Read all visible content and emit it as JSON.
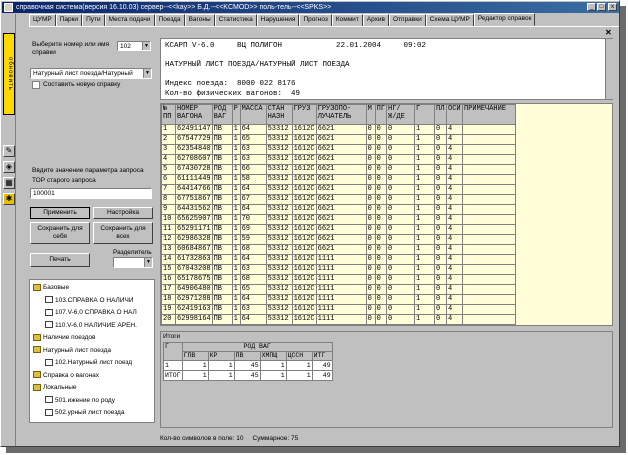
{
  "window": {
    "title": "справочная система(версия 16.10.03) сервер--<<kay>> Б.Д.--<<KCMOD>> поль-тель--<<SPKS>>",
    "controls": [
      "_",
      "□",
      "x"
    ]
  },
  "tabs": [
    "ЦУМР",
    "Парки",
    "Пути",
    "Места подачи",
    "Поезда",
    "Вагоны",
    "Статистика",
    "Нарушения",
    "Прогноз",
    "Коммит",
    "Архив",
    "Отправки",
    "Схема ЦУМР",
    "Редактор справок"
  ],
  "active_tab": 13,
  "close_glyph": "✕",
  "side": {
    "vertical_label": "обновить",
    "icons": [
      "pencil-icon",
      "paint-icon",
      "settings-icon",
      "tool-icon"
    ]
  },
  "left": {
    "choose_label": "Выберите номер или имя справки",
    "number_value": "102",
    "report_select": "Натурный лист поезда/Натурный",
    "new_report_checkbox": "Составить новую справку",
    "param_label": "Ввдите значение параметра запроса",
    "param_sub": "ТОР  старого запроса",
    "param_value": "100001",
    "buttons": {
      "apply": "Применить",
      "settings": "Настройка",
      "save_self": "Сохранить для себя",
      "save_all": "Сохранить для всех",
      "print": "Печать",
      "separator": "Разделитель"
    },
    "tree": [
      {
        "indent": 0,
        "icon": "folder",
        "label": "Базовые"
      },
      {
        "indent": 1,
        "icon": "doc",
        "label": "103.СПРАВКА О НАЛИЧИ"
      },
      {
        "indent": 1,
        "icon": "doc",
        "label": "107.V-6.0  СПРАВКА О НАЛ"
      },
      {
        "indent": 1,
        "icon": "doc",
        "label": "110.V-6.0  НАЛИЧИЕ АРЕН."
      },
      {
        "indent": 0,
        "icon": "folder",
        "label": "Наличие поездов"
      },
      {
        "indent": 0,
        "icon": "folder",
        "label": "Натурный лист поезда"
      },
      {
        "indent": 1,
        "icon": "doc",
        "label": "102.Натурный лист поезд"
      },
      {
        "indent": 0,
        "icon": "folder",
        "label": "Справка о вагонах"
      },
      {
        "indent": 0,
        "icon": "folder",
        "label": "Локальные"
      },
      {
        "indent": 1,
        "icon": "doc",
        "label": "501.ижение по роду"
      },
      {
        "indent": 1,
        "icon": "doc",
        "label": "502.урный лист поезда"
      }
    ]
  },
  "header_text": {
    "line1": "КСАРП V-6.0     ВЦ ПОЛИГОН            22.01.2004     09:02",
    "line2": "",
    "line3": "НАТУРНЫЙ ЛИСТ ПОЕЗДА/НАТУРНЫЙ ЛИСТ ПОЕЗДА",
    "line4": "",
    "line5": "Индекс поезда:  8000 022 8176",
    "line6": "Кол-во физических вагонов:  49"
  },
  "grid": {
    "columns": [
      "№ ПП",
      "НОМЕР ВАГОНА",
      "РОД ВАГ",
      "Р",
      "МАССА",
      "СТАН НАЗН",
      "ГРУЗ",
      "ГРУЗОПО- ЛУЧАТЕЛЬ",
      "М",
      "ПГ",
      "НГ/ Ж/ДЕ",
      "Г",
      "ПЛ",
      "ОСИ",
      "ПРИМЕЧАНИЕ"
    ],
    "rows": [
      [
        "1",
        "62491147",
        "ПВ",
        "1",
        "64",
        "53312",
        "1612С",
        "6621",
        "0",
        "0",
        "0",
        "1",
        "0",
        "4",
        ""
      ],
      [
        "2",
        "67547729",
        "ПВ",
        "1",
        "65",
        "53312",
        "1612С",
        "6621",
        "0",
        "0",
        "0",
        "1",
        "0",
        "4",
        ""
      ],
      [
        "3",
        "62354840",
        "ПВ",
        "1",
        "63",
        "53312",
        "1612С",
        "6621",
        "0",
        "0",
        "0",
        "1",
        "0",
        "4",
        ""
      ],
      [
        "4",
        "62708607",
        "ПВ",
        "1",
        "63",
        "53312",
        "1612С",
        "6621",
        "0",
        "0",
        "0",
        "1",
        "0",
        "4",
        ""
      ],
      [
        "5",
        "67430728",
        "ПВ",
        "1",
        "66",
        "53312",
        "1612С",
        "6621",
        "0",
        "0",
        "0",
        "1",
        "0",
        "4",
        ""
      ],
      [
        "6",
        "61111449",
        "ПВ",
        "1",
        "58",
        "53312",
        "1612С",
        "6621",
        "0",
        "0",
        "0",
        "1",
        "0",
        "4",
        ""
      ],
      [
        "7",
        "64414766",
        "ПВ",
        "1",
        "64",
        "53312",
        "1612С",
        "6621",
        "0",
        "0",
        "0",
        "1",
        "0",
        "4",
        ""
      ],
      [
        "8",
        "67751867",
        "ПВ",
        "1",
        "67",
        "53312",
        "1612С",
        "6621",
        "0",
        "0",
        "0",
        "1",
        "0",
        "4",
        ""
      ],
      [
        "9",
        "64431562",
        "ПВ",
        "1",
        "64",
        "53312",
        "1612С",
        "6621",
        "0",
        "0",
        "0",
        "1",
        "0",
        "4",
        ""
      ],
      [
        "10",
        "65625907",
        "ПВ",
        "1",
        "70",
        "53312",
        "1612С",
        "6621",
        "0",
        "0",
        "0",
        "1",
        "0",
        "4",
        ""
      ],
      [
        "11",
        "65291171",
        "ПВ",
        "1",
        "69",
        "53312",
        "1612С",
        "6621",
        "0",
        "0",
        "0",
        "1",
        "0",
        "4",
        ""
      ],
      [
        "12",
        "62986328",
        "ПВ",
        "1",
        "59",
        "53312",
        "1612С",
        "6621",
        "0",
        "0",
        "0",
        "1",
        "0",
        "4",
        ""
      ],
      [
        "13",
        "60684867",
        "ПВ",
        "1",
        "68",
        "53312",
        "1612С",
        "6621",
        "0",
        "0",
        "0",
        "1",
        "0",
        "4",
        ""
      ],
      [
        "14",
        "61732863",
        "ПВ",
        "1",
        "64",
        "53312",
        "1612С",
        "1111",
        "0",
        "0",
        "0",
        "1",
        "0",
        "4",
        ""
      ],
      [
        "15",
        "67043208",
        "ПВ",
        "1",
        "63",
        "53312",
        "1612С",
        "1111",
        "0",
        "0",
        "0",
        "1",
        "0",
        "4",
        ""
      ],
      [
        "16",
        "65178675",
        "ПВ",
        "1",
        "68",
        "53312",
        "1612С",
        "1111",
        "0",
        "0",
        "0",
        "1",
        "0",
        "4",
        ""
      ],
      [
        "17",
        "64906480",
        "ПВ",
        "1",
        "65",
        "53312",
        "1612С",
        "1111",
        "0",
        "0",
        "0",
        "1",
        "0",
        "4",
        ""
      ],
      [
        "18",
        "62971288",
        "ПВ",
        "1",
        "64",
        "53312",
        "1612С",
        "1111",
        "0",
        "0",
        "0",
        "1",
        "0",
        "4",
        ""
      ],
      [
        "19",
        "62419163",
        "ПВ",
        "1",
        "63",
        "53312",
        "1612С",
        "1111",
        "0",
        "0",
        "0",
        "1",
        "0",
        "4",
        ""
      ],
      [
        "20",
        "62998164",
        "ПВ",
        "1",
        "64",
        "53312",
        "1612С",
        "1111",
        "0",
        "0",
        "0",
        "1",
        "0",
        "4",
        ""
      ],
      [
        "21",
        "65219270",
        "ПВ",
        "1",
        "66",
        "53312",
        "1612С",
        "1111",
        "0",
        "0",
        "0",
        "1",
        "0",
        "4",
        ""
      ]
    ]
  },
  "totals": {
    "title": "Итоги",
    "group_label": "РОД ВАГ",
    "col_g": "Г",
    "columns": [
      "ГПВ",
      "КР",
      "ПВ",
      "ХМПЩ",
      "ЦССН",
      "ИТГ"
    ],
    "rows": [
      {
        "label": "1",
        "values": [
          "1",
          "1",
          "45",
          "1",
          "1",
          "49"
        ]
      },
      {
        "label": "ИТОГ",
        "values": [
          "1",
          "1",
          "45",
          "1",
          "1",
          "49"
        ]
      }
    ]
  },
  "status": {
    "chars_label": "Кол-во символов в поле:",
    "chars_value": "10",
    "total_label": "Суммарное:",
    "total_value": "75"
  }
}
